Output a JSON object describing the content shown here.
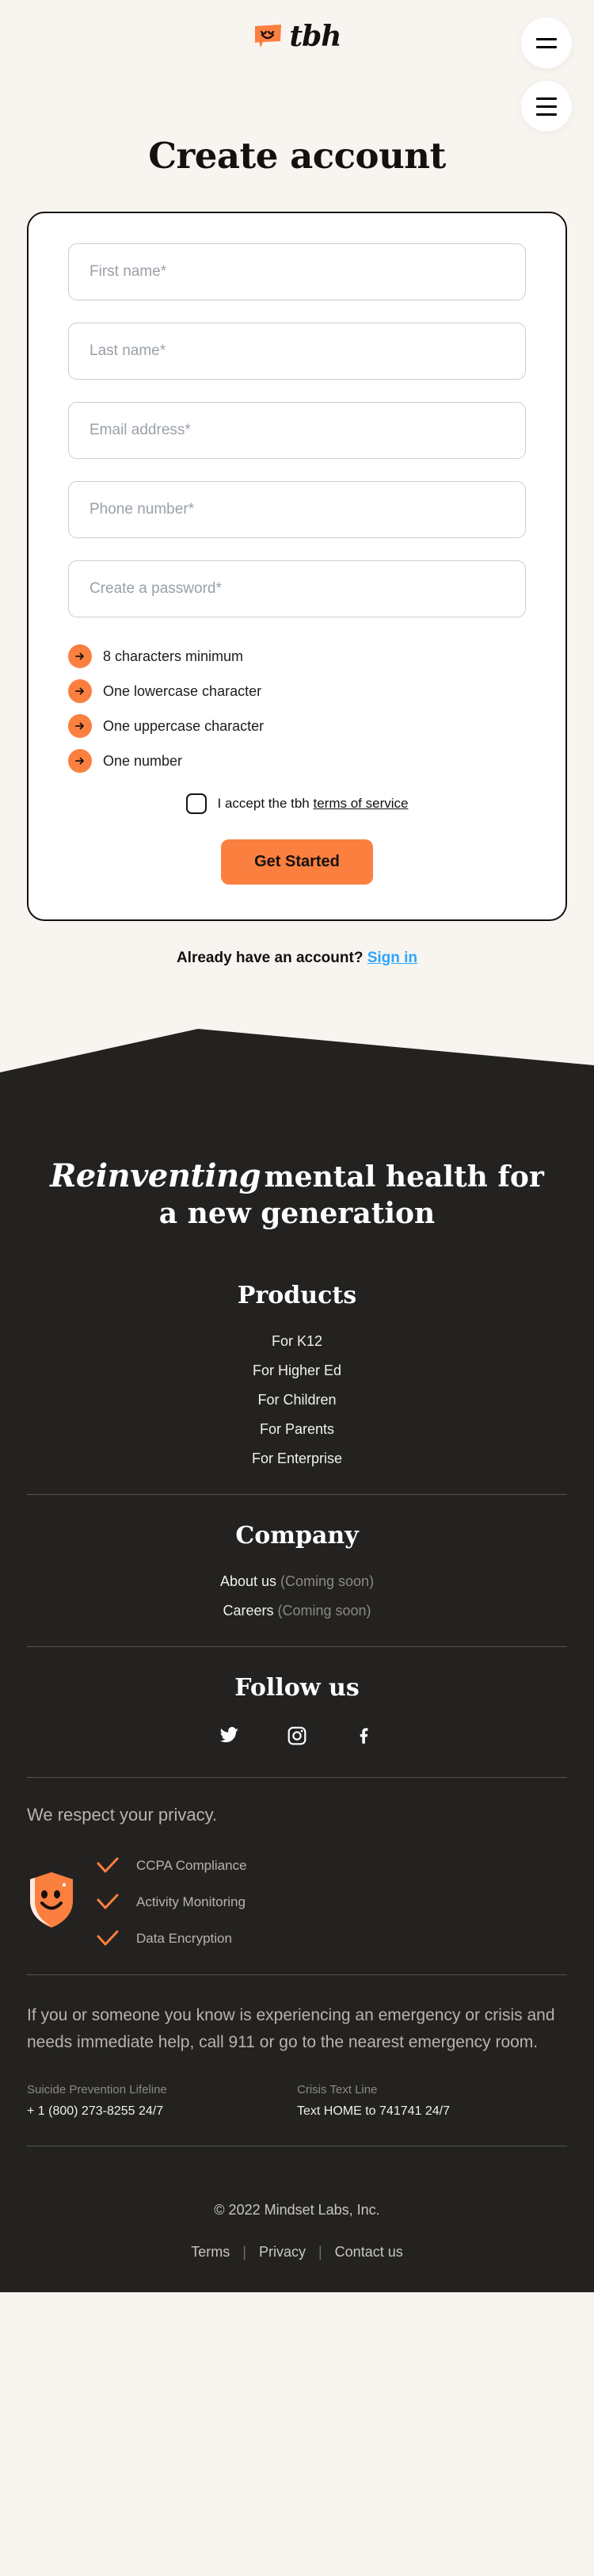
{
  "colors": {
    "page_bg": "#f8f4f0",
    "accent_orange": "#fb7f3f",
    "ink": "#16110f",
    "footer_bg": "#232220",
    "link_blue": "#2ea6ff"
  },
  "header": {
    "logo_word": "tbh",
    "logo_mark_icon": "smiley-speech-bubble-icon",
    "menu_button_icon": "hamburger-menu-icon",
    "menu_button_label": "Menu"
  },
  "page_title": "Create account",
  "form": {
    "fields": [
      {
        "name": "first-name",
        "placeholder": "First name*",
        "value": ""
      },
      {
        "name": "last-name",
        "placeholder": "Last name*",
        "value": ""
      },
      {
        "name": "email",
        "placeholder": "Email address*",
        "value": ""
      },
      {
        "name": "phone",
        "placeholder": "Phone number*",
        "value": ""
      },
      {
        "name": "password",
        "placeholder": "Create a password*",
        "value": ""
      }
    ],
    "password_requirements": [
      "8 characters minimum",
      "One lowercase character",
      "One uppercase character",
      "One number"
    ],
    "requirement_icon": "arrow-right-circle-icon",
    "accept": {
      "checked": false,
      "text_before": "I accept the tbh ",
      "link_text": "terms of service"
    },
    "submit_label": "Get Started"
  },
  "already_account": {
    "text": "Already have an account?",
    "link_text": "Sign in"
  },
  "footer": {
    "hero": {
      "script_word": "Reinventing",
      "rest_line1": "mental health for",
      "rest_line2": "a new generation"
    },
    "products": {
      "title": "Products",
      "links": [
        "For K12",
        "For Higher Ed",
        "For Children",
        "For Parents",
        "For Enterprise"
      ]
    },
    "company": {
      "title": "Company",
      "links": [
        {
          "label": "About us",
          "note": "(Coming soon)"
        },
        {
          "label": "Careers",
          "note": "(Coming soon)"
        }
      ]
    },
    "follow": {
      "title": "Follow us",
      "socials": [
        {
          "name": "twitter-icon",
          "label": "Twitter"
        },
        {
          "name": "instagram-icon",
          "label": "Instagram"
        },
        {
          "name": "facebook-icon",
          "label": "Facebook"
        }
      ]
    },
    "privacy": {
      "heading": "We respect your privacy.",
      "shield_icon": "shield-smiley-icon",
      "items": [
        "CCPA Compliance",
        "Activity Monitoring",
        "Data Encryption"
      ]
    },
    "emergency_notice": "If you or someone you know is experiencing an emergency or crisis and needs immediate help, call 911 or go to the nearest emergency room.",
    "hotlines": [
      {
        "name": "Suicide Prevention Lifeline",
        "value": "+ 1 (800) 273-8255 24/7"
      },
      {
        "name": "Crisis Text Line",
        "value": "Text HOME to 741741 24/7"
      }
    ],
    "copyright": "© 2022 Mindset Labs, Inc.",
    "bottom_links": [
      "Terms",
      "Privacy",
      "Contact us"
    ],
    "bottom_separator": "|"
  }
}
